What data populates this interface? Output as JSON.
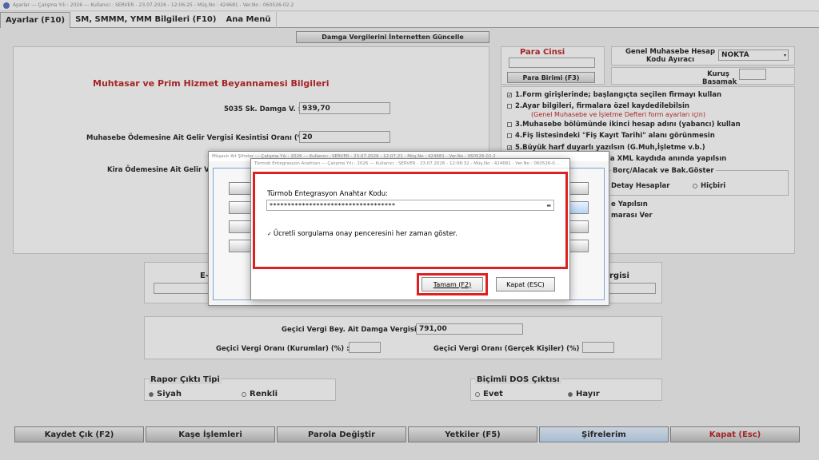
{
  "window": {
    "title": "Ayarlar  ---  Çalışma Yılı : 2026  ---  Kullanıcı : SERVER - 23.07.2026 - 12:06:25 - Müş.No : 424681 - Ver.No : 060526-02.2"
  },
  "tabs": [
    "Ayarlar (F10)",
    "SM, SMMM, YMM Bilgileri (F10)",
    "Ana Menü"
  ],
  "top_button": "Damga Vergilerini İnternetten Güncelle",
  "muhtasar": {
    "title": "Muhtasar ve Prim Hizmet Beyannamesi Bilgileri",
    "damga_label": "5035 Sk. Damga V. :",
    "damga_value": "939,70",
    "muhasebe_label": "Muhasebe Ödemesine Ait Gelir Vergisi Kesintisi Oranı (%) :",
    "muhasebe_value": "20",
    "kira_label": "Kira Ödemesine Ait Gelir Ver"
  },
  "para": {
    "title": "Para Cinsi",
    "button": "Para Birimi (F3)"
  },
  "genel": {
    "label": "Genel Muhasebe Hesap Kodu Ayıracı",
    "value": "NOKTA",
    "kurus_label": "Kuruş Basamak"
  },
  "options": {
    "o1": "1.Form girişlerinde; başlangıçta seçilen firmayı kullan",
    "o2": "2.Ayar bilgileri, firmalara özel kaydedilebilsin",
    "o2_note": "(Genel Muhasebe ve İşletme Defteri form ayarları için)",
    "o3": "3.Muhasebe bölümünde ikinci hesap adını (yabancı) kullan",
    "o4": "4.Fiş listesindeki \"Fiş Kayıt Tarihi\" alanı görünmesin",
    "o5": "5.Büyük harf duyarlı yazılsın (G.Muh,İşletme v.b.)",
    "o6_tail": "la XML kaydıda anında yapılsın",
    "group_title": "Borç/Alacak ve Bak.Göster",
    "detay": "Detay Hesaplar",
    "hicbiri": "Hiçbiri",
    "yapilsin_tail": "e Yapılsın",
    "numara_tail": "marası Ver"
  },
  "mid": {
    "e_label": "E-",
    "vergisi_tail": "rgisi"
  },
  "gecici": {
    "damga_label": "Geçici Vergi Bey. Ait Damga Vergisi :",
    "damga_value": "791,00",
    "kurumlar_label": "Geçici Vergi Oranı (Kurumlar) (%) :",
    "gercek_label": "Geçici Vergi Oranı (Gerçek Kişiler) (%) :"
  },
  "rapor": {
    "title": "Rapor Çıktı Tipi",
    "siyah": "Siyah",
    "renkli": "Renkli"
  },
  "dos": {
    "title": "Biçimli DOS Çıktısı",
    "evet": "Evet",
    "hayir": "Hayır"
  },
  "bottom_buttons": [
    "Kaydet Çık (F2)",
    "Kaşe İşlemleri",
    "Parola Değiştir",
    "Yetkiler (F5)",
    "Şifrelerim",
    "Kapat (Esc)"
  ],
  "dialog_back": {
    "title": "Müşavir Ait Şifreler  ---  Çalışma Yılı : 2026  ---  Kullanıcı : SERVER - 23.07.2026 - 12:07:21 - Müş.No : 424681 - Ver.No : 060526-02.2"
  },
  "dialog": {
    "title": "Türmob Entegrasyon Anahtarı  ---  Çalışma Yılı : 2026  ---  Kullanıcı : SERVER - 23.07.2026 - 12:08:32 - Müş.No : 424681 - Ver.No : 060526-0...",
    "field_label": "Türmob Entegrasyon Anahtar Kodu:",
    "field_value": "***********************************",
    "checkbox_label": "Ücretli sorgulama onay penceresini her zaman göster.",
    "ok": "Tamam (F2)",
    "cancel": "Kapat (ESC)"
  },
  "colors": {
    "highlight": "#e02020",
    "title_red": "#b30000"
  }
}
